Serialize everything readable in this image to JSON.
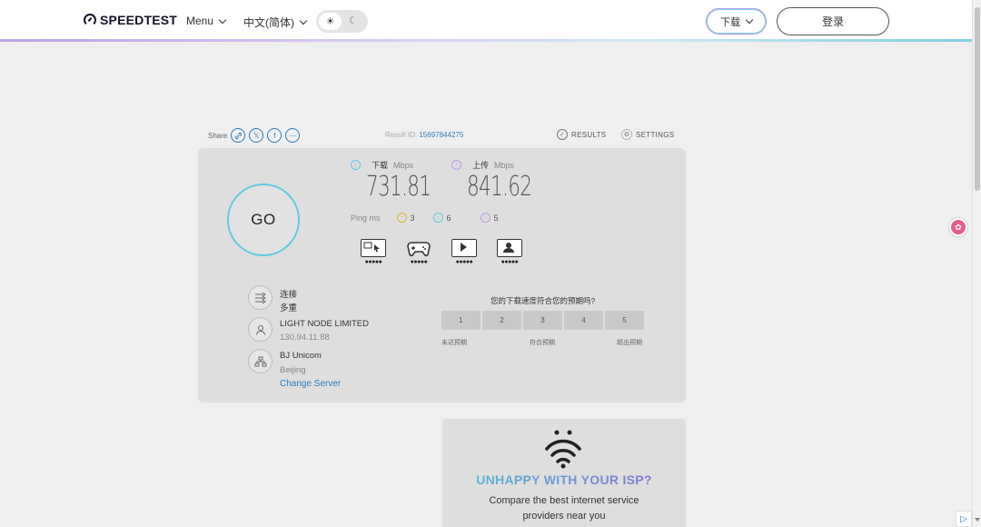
{
  "header": {
    "logo": "SPEEDTEST",
    "menu_label": "Menu",
    "language_label": "中文(简体)",
    "download_label": "下载",
    "login_label": "登录"
  },
  "share": {
    "label": "Share",
    "result_prefix": "Result ID:",
    "result_id": "15697844275",
    "results_label": "RESULTS",
    "settings_label": "SETTINGS"
  },
  "test": {
    "go_label": "GO",
    "download_label": "下载",
    "upload_label": "上传",
    "unit": "Mbps",
    "download_value": "731.81",
    "upload_value": "841.62",
    "ping_label": "Ping ms",
    "ping_idle": "3",
    "ping_download": "6",
    "ping_upload": "5",
    "activity_rating": "●●●●●"
  },
  "server": {
    "connections_label": "连接",
    "connections_value": "多重",
    "host_name": "LIGHT NODE LIMITED",
    "host_ip": "130.94.11.88",
    "isp_name": "BJ Unicom",
    "isp_city": "Beijing",
    "change_server": "Change Server"
  },
  "rating": {
    "question": "您的下载速度符合您的预期吗?",
    "options": [
      "1",
      "2",
      "3",
      "4",
      "5"
    ],
    "legend_low": "未达预期",
    "legend_mid": "符合预期",
    "legend_high": "超出预期"
  },
  "ad": {
    "title": "UNHAPPY WITH YOUR ISP?",
    "line1": "Compare the best internet service",
    "line2": "providers near you"
  },
  "colors": {
    "accent_cyan": "#5ccbe0",
    "accent_purple": "#b79be6",
    "link_blue": "#2a7bbf",
    "ping_yellow": "#d9b62a"
  }
}
